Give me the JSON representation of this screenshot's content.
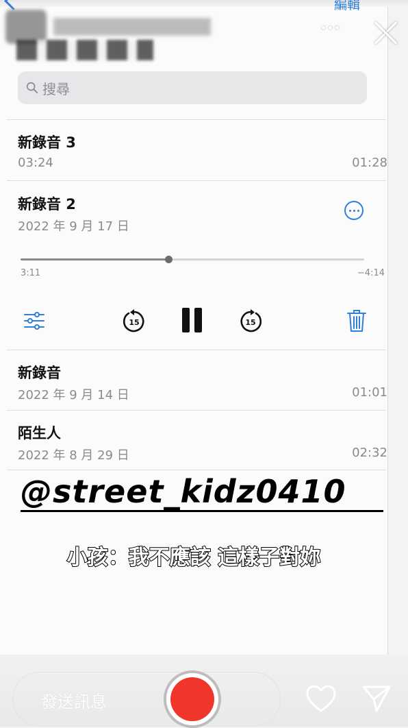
{
  "header": {
    "edit_label": "編輯"
  },
  "search": {
    "placeholder": "搜尋"
  },
  "recordings": [
    {
      "title": "新錄音 3",
      "subtitle": "03:24",
      "duration": "01:28"
    },
    {
      "title": "新錄音 2",
      "subtitle": "2022 年 9 月 17 日",
      "duration": ""
    },
    {
      "title": "新錄音",
      "subtitle": "2022 年 9 月 14 日",
      "duration": "01:01"
    },
    {
      "title": "陌生人",
      "subtitle": "2022 年 8 月 29 日",
      "duration": "02:32"
    }
  ],
  "player": {
    "elapsed": "3:11",
    "remaining": "−4:14",
    "progress": 0.43,
    "skip_back_seconds": "15",
    "skip_forward_seconds": "15"
  },
  "overlay": {
    "watermark": "@street_kidz0410",
    "subtitle": "小孩：我不應該 這樣子對妳"
  },
  "story_bar": {
    "message_placeholder": "發送訊息"
  },
  "colors": {
    "accent": "#2f7fd6",
    "record": "#f0362a"
  }
}
